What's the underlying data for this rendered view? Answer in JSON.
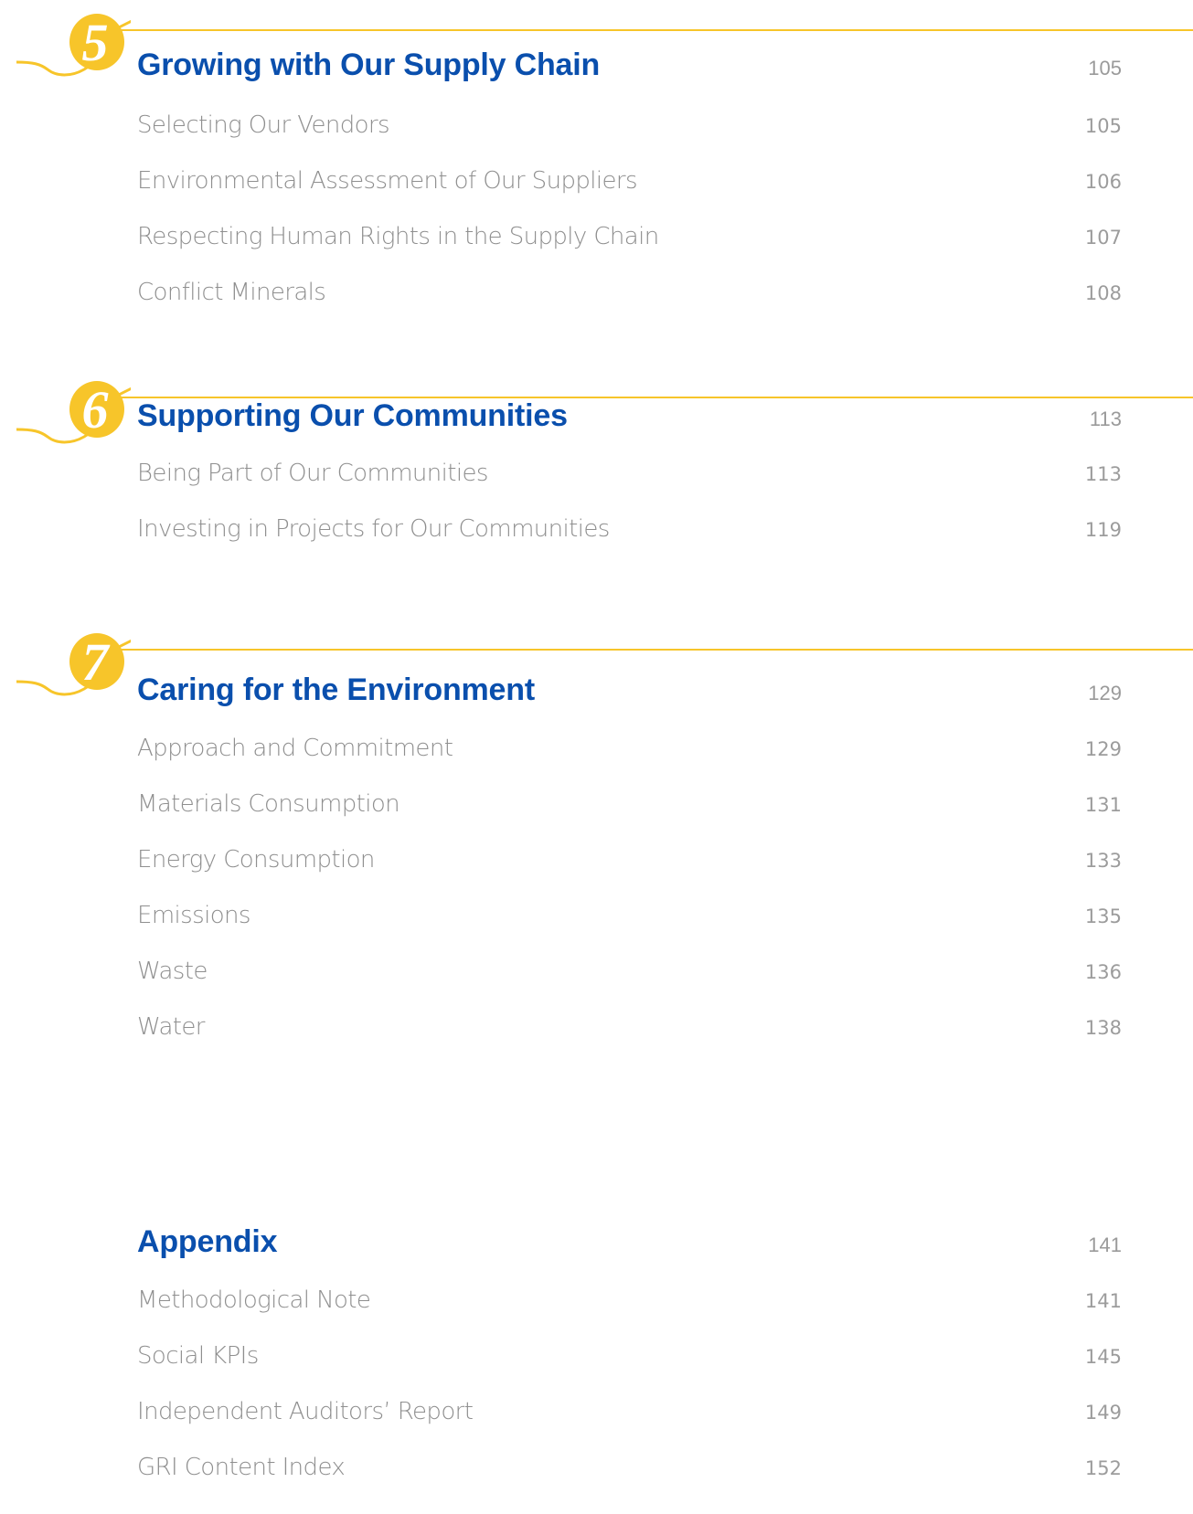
{
  "sections": [
    {
      "number": "5",
      "title": "Growing with Our Supply Chain",
      "page": "105",
      "items": [
        {
          "title": "Selecting Our Vendors",
          "page": "105"
        },
        {
          "title": "Environmental Assessment of Our Suppliers",
          "page": "106"
        },
        {
          "title": "Respecting Human Rights in the Supply Chain",
          "page": "107"
        },
        {
          "title": "Conflict Minerals",
          "page": "108"
        }
      ]
    },
    {
      "number": "6",
      "title": "Supporting Our Communities",
      "page": "113",
      "items": [
        {
          "title": "Being Part of Our Communities",
          "page": "113"
        },
        {
          "title": "Investing in Projects for Our Communities",
          "page": "119"
        }
      ]
    },
    {
      "number": "7",
      "title": "Caring for the Environment",
      "page": "129",
      "items": [
        {
          "title": "Approach and Commitment",
          "page": "129"
        },
        {
          "title": "Materials Consumption",
          "page": "131"
        },
        {
          "title": "Energy Consumption",
          "page": "133"
        },
        {
          "title": "Emissions",
          "page": "135"
        },
        {
          "title": "Waste",
          "page": "136"
        },
        {
          "title": "Water",
          "page": "138"
        }
      ]
    },
    {
      "title": "Appendix",
      "page": "141",
      "items": [
        {
          "title": "Methodological Note",
          "page": "141"
        },
        {
          "title": "Social KPIs",
          "page": "145"
        },
        {
          "title": "Independent Auditors’ Report",
          "page": "149"
        },
        {
          "title": "GRI Content Index",
          "page": "152"
        }
      ]
    }
  ],
  "colors": {
    "heading": "#0a4fad",
    "accent": "#f7c52a",
    "text": "#8f8f8f"
  }
}
